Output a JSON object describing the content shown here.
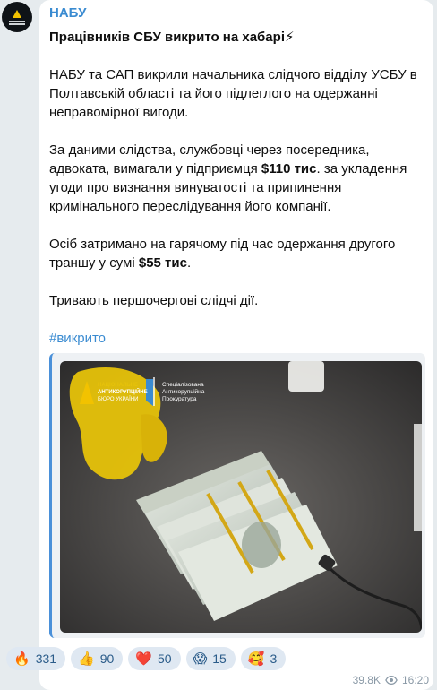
{
  "channel": {
    "name": "НАБУ"
  },
  "post": {
    "title": "Працівників СБУ викрито на хабарі⚡",
    "p1": "НАБУ та САП викрили начальника слідчого відділу УСБУ в Полтавській області та його підлеглого на одержанні неправомірної вигоди.",
    "p2_a": "За даними слідства, службовці через посередника, адвоката, вимагали у підприємця ",
    "p2_b": "$110 тис",
    "p2_c": ". за укладення угоди про визнання винуватості та припинення кримінального переслідування його компанії.",
    "p3_a": "Осіб затримано на гарячому під час одержання другого траншу у сумі ",
    "p3_b": "$55 тис",
    "p3_c": ".",
    "p4": "Тривають першочергові слідчі дії.",
    "hashtag": "#викрито"
  },
  "media": {
    "logo_nabu_lines": [
      "НАЦІОНАЛЬНЕ",
      "АНТИКОРУПЦІЙНЕ",
      "БЮРО УКРАЇНИ"
    ],
    "logo_sap_lines": [
      "Спеціалізована",
      "Антикорупційна",
      "Прокуратура"
    ]
  },
  "reactions": [
    {
      "icon": "fire-icon",
      "emoji": "🔥",
      "count": "331"
    },
    {
      "icon": "thumbs-up-icon",
      "emoji": "👍",
      "count": "90"
    },
    {
      "icon": "heart-icon",
      "emoji": "❤️",
      "count": "50"
    },
    {
      "icon": "screaming-face-icon",
      "emoji": "😱",
      "count": "15"
    },
    {
      "icon": "smiling-hearts-icon",
      "emoji": "🥰",
      "count": "3"
    }
  ],
  "meta": {
    "views": "39.8K",
    "time": "16:20"
  },
  "colors": {
    "link": "#3a8bd1",
    "reaction_bg": "#dfe8f2",
    "quote_bar": "#4a90d9"
  }
}
